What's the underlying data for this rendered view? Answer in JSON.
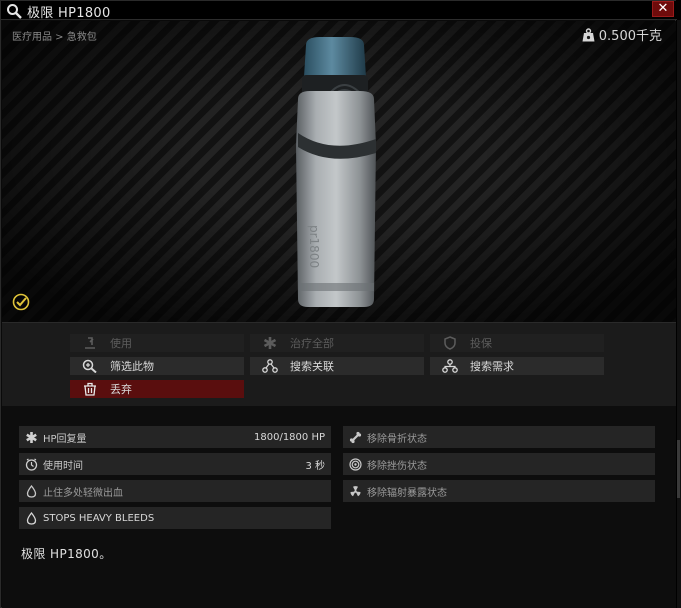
{
  "window": {
    "title": "极限 HP1800",
    "close_label": "✕"
  },
  "preview": {
    "breadcrumb": "医疗用品 > 急救包",
    "weight": "0.500千克"
  },
  "actions": {
    "use": "使用",
    "heal_all": "治疗全部",
    "insure": "投保",
    "filter_item": "筛选此物",
    "search_linked": "搜索关联",
    "search_required": "搜索需求",
    "discard": "丢弃"
  },
  "stats": {
    "hp_restore_label": "HP回复量",
    "hp_restore_value": "1800/1800 HP",
    "use_time_label": "使用时间",
    "use_time_value": "3 秒",
    "light_bleed_label": "止住多处轻微出血",
    "heavy_bleed_label": "STOPS HEAVY BLEEDS",
    "remove_fracture_label": "移除骨折状态",
    "remove_contusion_label": "移除挫伤状态",
    "remove_radiation_label": "移除辐射暴露状态"
  },
  "description": "极限 HP1800。",
  "colors": {
    "danger": "#5a0e0e",
    "close": "#6e0b0b",
    "check": "#e0c43a"
  }
}
